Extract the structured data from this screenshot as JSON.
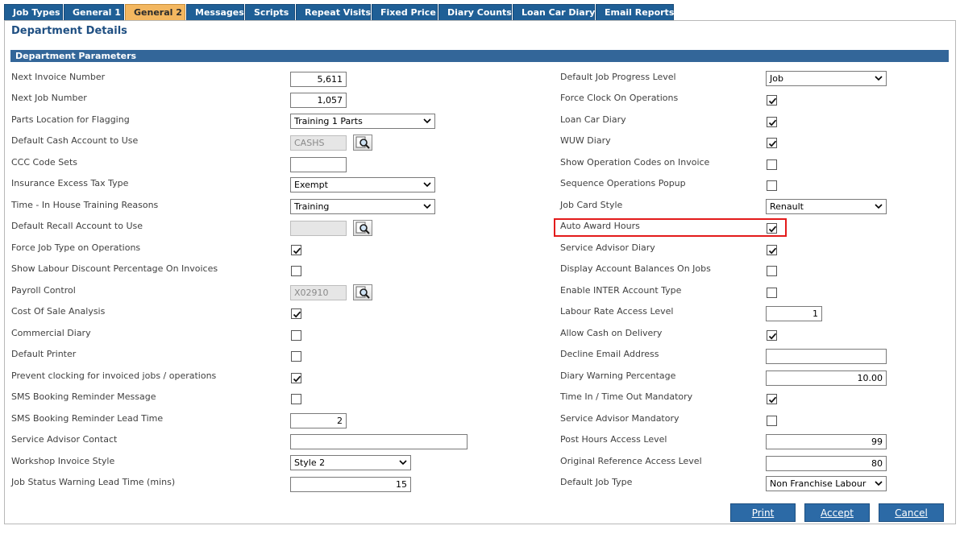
{
  "tabs": [
    "Job Types",
    "General 1",
    "General 2",
    "Messages",
    "Scripts",
    "Repeat Visits",
    "Fixed Price",
    "Diary Counts",
    "Loan Car Diary",
    "Email Reports"
  ],
  "page_title": "Department Details",
  "section_title": "Department Parameters",
  "left": {
    "next_invoice_number": {
      "label": "Next Invoice Number",
      "value": "5,611"
    },
    "next_job_number": {
      "label": "Next Job Number",
      "value": "1,057"
    },
    "parts_location": {
      "label": "Parts Location for Flagging",
      "value": "Training 1 Parts"
    },
    "default_cash_account": {
      "label": "Default Cash Account to Use",
      "value": "CASHS"
    },
    "ccc_code_sets": {
      "label": "CCC Code Sets",
      "value": ""
    },
    "insurance_excess_tax": {
      "label": "Insurance Excess Tax Type",
      "value": "Exempt"
    },
    "in_house_training": {
      "label": "Time - In House Training Reasons",
      "value": "Training"
    },
    "default_recall_account": {
      "label": "Default Recall Account to Use",
      "value": ""
    },
    "force_job_type": {
      "label": "Force Job Type on Operations",
      "checked": true
    },
    "show_labour_discount": {
      "label": "Show Labour Discount Percentage On Invoices",
      "checked": false
    },
    "payroll_control": {
      "label": "Payroll Control",
      "value": "X02910"
    },
    "cost_of_sale": {
      "label": "Cost Of Sale Analysis",
      "checked": true
    },
    "commercial_diary": {
      "label": "Commercial Diary",
      "checked": false
    },
    "default_printer": {
      "label": "Default Printer",
      "checked": false
    },
    "prevent_clocking": {
      "label": "Prevent clocking for invoiced jobs / operations",
      "checked": true
    },
    "sms_reminder_message": {
      "label": "SMS Booking Reminder Message",
      "checked": false
    },
    "sms_reminder_lead": {
      "label": "SMS Booking Reminder Lead Time",
      "value": "2"
    },
    "service_advisor_contact": {
      "label": "Service Advisor Contact",
      "value": ""
    },
    "workshop_invoice_style": {
      "label": "Workshop Invoice Style",
      "value": "Style 2"
    },
    "job_status_warning": {
      "label": "Job Status Warning Lead Time (mins)",
      "value": "15"
    }
  },
  "right": {
    "default_job_progress": {
      "label": "Default Job Progress Level",
      "value": "Job"
    },
    "force_clock_on": {
      "label": "Force Clock On Operations",
      "checked": true
    },
    "loan_car_diary": {
      "label": "Loan Car Diary",
      "checked": true
    },
    "wuw_diary": {
      "label": "WUW Diary",
      "checked": true
    },
    "show_operation_codes": {
      "label": "Show Operation Codes on Invoice",
      "checked": false
    },
    "sequence_operations": {
      "label": "Sequence Operations Popup",
      "checked": false
    },
    "job_card_style": {
      "label": "Job Card Style",
      "value": "Renault"
    },
    "auto_award_hours": {
      "label": "Auto Award Hours",
      "checked": true
    },
    "service_advisor_diary": {
      "label": "Service Advisor Diary",
      "checked": true
    },
    "display_account_balances": {
      "label": "Display Account Balances On Jobs",
      "checked": false
    },
    "enable_inter_account": {
      "label": "Enable INTER Account Type",
      "checked": false
    },
    "labour_rate_access": {
      "label": "Labour Rate Access Level",
      "value": "1"
    },
    "allow_cash_on_delivery": {
      "label": "Allow Cash on Delivery",
      "checked": true
    },
    "decline_email": {
      "label": "Decline Email Address",
      "value": ""
    },
    "diary_warning_percentage": {
      "label": "Diary Warning Percentage",
      "value": "10.00"
    },
    "time_in_out_mandatory": {
      "label": "Time In / Time Out Mandatory",
      "checked": true
    },
    "service_advisor_mandatory": {
      "label": "Service Advisor Mandatory",
      "checked": false
    },
    "post_hours_access": {
      "label": "Post Hours Access Level",
      "value": "99"
    },
    "original_reference_access": {
      "label": "Original Reference Access Level",
      "value": "80"
    },
    "default_job_type": {
      "label": "Default Job Type",
      "value": "Non Franchise Labour"
    }
  },
  "buttons": {
    "print": "Print",
    "accept": "Accept",
    "cancel": "Cancel"
  },
  "colors": {
    "tab_blue": "#1f5f96",
    "tab_active": "#f3b760",
    "section_bar": "#336699",
    "highlight": "#e31b1b",
    "button": "#2c6aa6"
  }
}
